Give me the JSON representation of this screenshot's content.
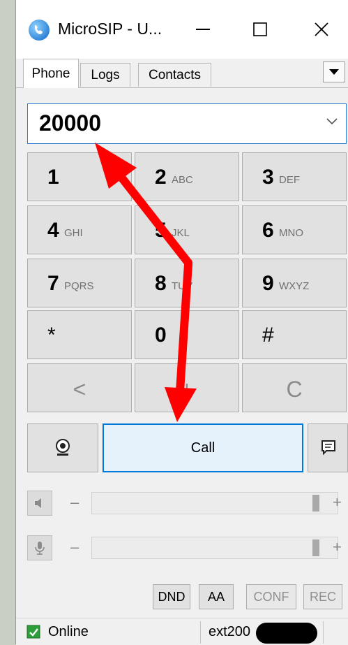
{
  "window": {
    "title": "MicroSIP - U...",
    "controls": {
      "minimize": "—",
      "maximize": "☐",
      "close": "✕"
    }
  },
  "tabs": [
    {
      "label": "Phone",
      "active": true
    },
    {
      "label": "Logs",
      "active": false
    },
    {
      "label": "Contacts",
      "active": false
    }
  ],
  "dial": {
    "number": "20000"
  },
  "keypad": [
    {
      "digit": "1",
      "letters": ""
    },
    {
      "digit": "2",
      "letters": "ABC"
    },
    {
      "digit": "3",
      "letters": "DEF"
    },
    {
      "digit": "4",
      "letters": "GHI"
    },
    {
      "digit": "5",
      "letters": "JKL"
    },
    {
      "digit": "6",
      "letters": "MNO"
    },
    {
      "digit": "7",
      "letters": "PQRS"
    },
    {
      "digit": "8",
      "letters": "TUV"
    },
    {
      "digit": "9",
      "letters": "WXYZ"
    },
    {
      "digit": "*",
      "letters": ""
    },
    {
      "digit": "0",
      "letters": ""
    },
    {
      "digit": "#",
      "letters": ""
    }
  ],
  "controls": {
    "backspace": "<",
    "plus": "+",
    "clear": "C"
  },
  "call_label": "Call",
  "volume": {
    "minus": "–",
    "plus": "+"
  },
  "buttons": {
    "dnd": "DND",
    "aa": "AA",
    "conf": "CONF",
    "rec": "REC"
  },
  "status": {
    "state": "Online",
    "account": "ext200"
  },
  "colors": {
    "accent": "#0078d7",
    "call_bg": "#e5f1fb",
    "arrow": "#ff0000"
  }
}
